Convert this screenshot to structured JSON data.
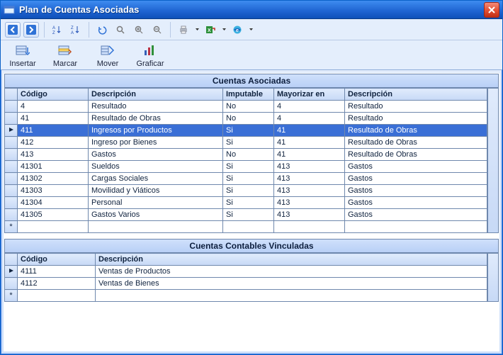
{
  "window": {
    "title": "Plan de Cuentas Asociadas"
  },
  "commands": {
    "insertar": "Insertar",
    "marcar": "Marcar",
    "mover": "Mover",
    "graficar": "Graficar"
  },
  "sections": {
    "top_title": "Cuentas Asociadas",
    "bottom_title": "Cuentas Contables Vinculadas"
  },
  "top_table": {
    "headers": {
      "codigo": "Código",
      "descripcion": "Descripción",
      "imputable": "Imputable",
      "mayorizar": "Mayorizar en",
      "descripcion2": "Descripción"
    },
    "rows": [
      {
        "codigo": "4",
        "descripcion": "Resultado",
        "imputable": "No",
        "mayorizar": "4",
        "descripcion2": "Resultado"
      },
      {
        "codigo": "41",
        "descripcion": "Resultado de Obras",
        "imputable": "No",
        "mayorizar": "4",
        "descripcion2": "Resultado"
      },
      {
        "codigo": "411",
        "descripcion": "Ingresos por Productos",
        "imputable": "Si",
        "mayorizar": "41",
        "descripcion2": "Resultado de Obras",
        "selected": true
      },
      {
        "codigo": "412",
        "descripcion": "Ingreso por Bienes",
        "imputable": "Si",
        "mayorizar": "41",
        "descripcion2": "Resultado de Obras"
      },
      {
        "codigo": "413",
        "descripcion": "Gastos",
        "imputable": "No",
        "mayorizar": "41",
        "descripcion2": "Resultado de Obras"
      },
      {
        "codigo": "41301",
        "descripcion": "Sueldos",
        "imputable": "Si",
        "mayorizar": "413",
        "descripcion2": "Gastos"
      },
      {
        "codigo": "41302",
        "descripcion": "Cargas Sociales",
        "imputable": "Si",
        "mayorizar": "413",
        "descripcion2": "Gastos"
      },
      {
        "codigo": "41303",
        "descripcion": "Movilidad y Viáticos",
        "imputable": "Si",
        "mayorizar": "413",
        "descripcion2": "Gastos"
      },
      {
        "codigo": "41304",
        "descripcion": "Personal",
        "imputable": "Si",
        "mayorizar": "413",
        "descripcion2": "Gastos"
      },
      {
        "codigo": "41305",
        "descripcion": "Gastos Varios",
        "imputable": "Si",
        "mayorizar": "413",
        "descripcion2": "Gastos"
      }
    ],
    "new_row_marker": "*"
  },
  "bottom_table": {
    "headers": {
      "codigo": "Código",
      "descripcion": "Descripción"
    },
    "rows": [
      {
        "codigo": "4111",
        "descripcion": "Ventas de Productos",
        "current": true
      },
      {
        "codigo": "4112",
        "descripcion": "Ventas de Bienes"
      }
    ],
    "new_row_marker": "*"
  }
}
